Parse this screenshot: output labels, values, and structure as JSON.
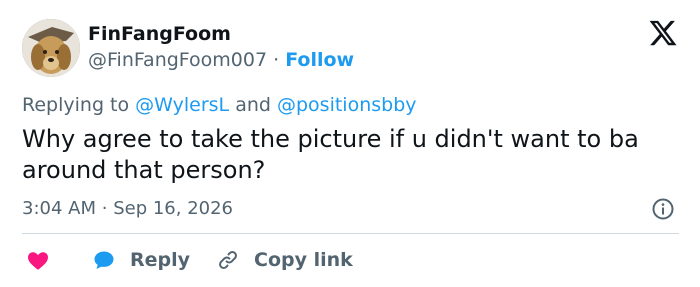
{
  "author": {
    "name": "FinFangFoom",
    "handle": "@FinFangFoom007",
    "separator": "·",
    "follow_label": "Follow"
  },
  "replying": {
    "prefix": "Replying to",
    "mention1": "@WylersL",
    "conjunction": "and",
    "mention2": "@positionsbby"
  },
  "tweet": {
    "text": "Why agree to take the picture if u didn't want to ba around that person?",
    "time": "3:04 AM",
    "separator": "·",
    "date": "Sep 16, 2026"
  },
  "actions": {
    "reply_label": "Reply",
    "copy_label": "Copy link"
  },
  "colors": {
    "accent": "#1d9bf0",
    "heart": "#f91880",
    "muted": "#536471",
    "text": "#0f1419"
  },
  "icons": {
    "logo": "x-logo-icon",
    "info": "info-icon",
    "like": "heart-icon",
    "reply": "reply-bubble-icon",
    "copy": "link-icon"
  }
}
